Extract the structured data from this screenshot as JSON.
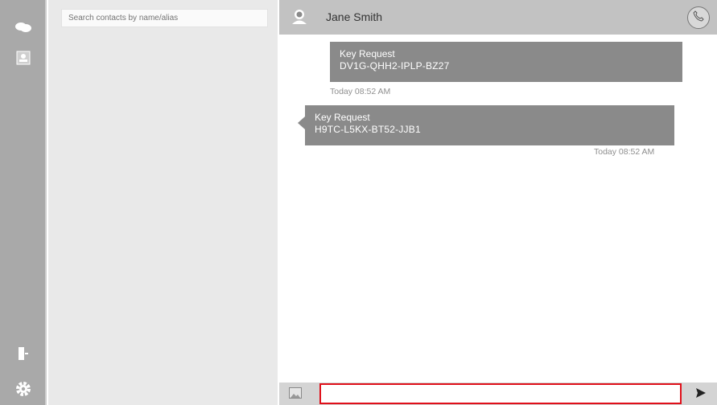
{
  "sidebar": {
    "icons": [
      "chat-bubbles-icon",
      "contacts-icon",
      "logout-icon",
      "gear-icon"
    ]
  },
  "contacts": {
    "search_placeholder": "Search contacts by name/alias"
  },
  "header": {
    "contact_name": "Jane Smith"
  },
  "messages": [
    {
      "title": "Key Request",
      "code": "DV1G-QHH2-IPLP-BZ27",
      "time": "Today 08:52 AM",
      "direction": "outgoing"
    },
    {
      "title": "Key Request",
      "code": "H9TC-L5KX-BT52-JJB1",
      "time": "Today 08:52 AM",
      "direction": "incoming"
    }
  ],
  "composer": {
    "value": "",
    "placeholder": ""
  },
  "colors": {
    "rail": "#a9a9a9",
    "contacts_bg": "#e9e9e9",
    "header_bg": "#c2c2c2",
    "bubble": "#8a8a8a",
    "input_highlight": "#e0101a"
  }
}
